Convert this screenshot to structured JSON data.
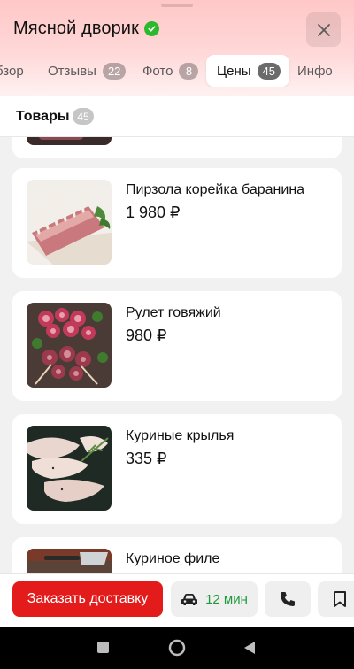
{
  "header": {
    "title": "Мясной дворик",
    "tabs": [
      {
        "label": "бзор",
        "count": null
      },
      {
        "label": "Отзывы",
        "count": "22"
      },
      {
        "label": "Фото",
        "count": "8"
      },
      {
        "label": "Цены",
        "count": "45",
        "active": true
      },
      {
        "label": "Инфо",
        "count": null
      }
    ]
  },
  "section": {
    "title": "Товары",
    "count": "45"
  },
  "products": [
    {
      "name": "Пирзола корейка баранина",
      "price": "1 980 ₽"
    },
    {
      "name": "Рулет говяжий",
      "price": "980 ₽"
    },
    {
      "name": "Куриные крылья",
      "price": "335 ₽"
    },
    {
      "name": "Куриное филе",
      "price": ""
    }
  ],
  "bottom": {
    "order_label": "Заказать доставку",
    "eta": "12 мин"
  },
  "colors": {
    "accent": "#e31b1b",
    "eta": "#1f9a3a",
    "verified": "#2eb82e"
  },
  "icons": [
    "check-icon",
    "close-icon",
    "car-icon",
    "phone-icon",
    "bookmark-icon"
  ]
}
